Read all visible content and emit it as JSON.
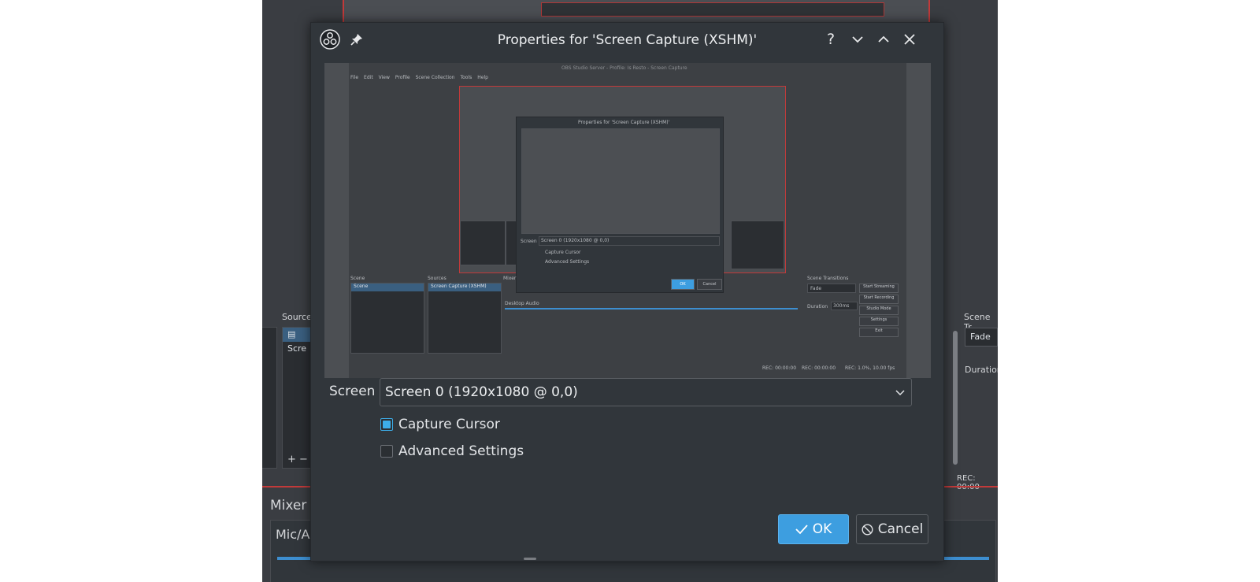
{
  "background": {
    "sources_label": "Source",
    "sources_item": "Scre",
    "scene_transitions_label": "Scene Tr",
    "transition_value": "Fade",
    "duration_label": "Duration",
    "rec_status": "REC: 00:00",
    "mixer_label": "Mixer",
    "mixer_channel": "Mic/A",
    "add_remove": "+ −"
  },
  "dialog": {
    "title": "Properties for 'Screen Capture (XSHM)'",
    "icons": {
      "app": "obs-logo-icon",
      "pin": "pin-icon",
      "help": "help-icon",
      "minimize": "chevron-down-icon",
      "maximize": "chevron-up-icon",
      "close": "close-icon"
    },
    "preview": {
      "menu": [
        "File",
        "Edit",
        "View",
        "Profile",
        "Scene Collection",
        "Tools",
        "Help"
      ],
      "window_title": "OBS Studio Server - Profile: Is Resto - Screen Capture",
      "inner_dialog_title": "Properties for 'Screen Capture (XSHM)'",
      "inner_screen_label": "Screen",
      "inner_screen_value": "Screen 0 (1920x1080 @ 0,0)",
      "inner_capture_cursor": "Capture Cursor",
      "inner_advanced": "Advanced Settings",
      "inner_ok": "OK",
      "inner_cancel": "Cancel",
      "scenes_label": "Scene",
      "scene_item": "Scene",
      "sources_label": "Sources",
      "source_item": "Screen Capture (XSHM)",
      "mixer_label": "Mixer",
      "desktop_audio": "Desktop Audio",
      "transitions_label": "Scene Transitions",
      "transition_value": "Fade",
      "duration_label": "Duration",
      "duration_value": "300ms",
      "controls": [
        "Start Streaming",
        "Start Recording",
        "Studio Mode",
        "Settings",
        "Exit"
      ],
      "status": "REC: 00:00:00",
      "status_cpu": "REC: 00:00:00",
      "status_fps": "REC: 1.0%, 10.00 fps"
    },
    "screen_label": "Screen",
    "screen_value": "Screen 0 (1920x1080 @ 0,0)",
    "capture_cursor_label": "Capture Cursor",
    "capture_cursor_checked": true,
    "advanced_settings_label": "Advanced Settings",
    "advanced_settings_checked": false,
    "ok_label": "OK",
    "cancel_label": "Cancel"
  },
  "colors": {
    "accent": "#3daee9",
    "ok_button": "#3d9ee0",
    "dialog_bg": "#31363b",
    "recording_border": "#c23a3a"
  }
}
